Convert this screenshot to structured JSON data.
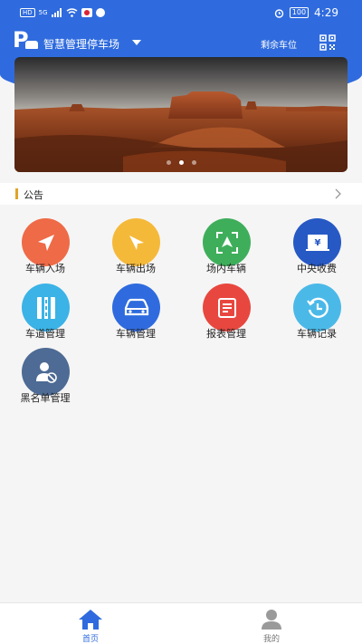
{
  "status_bar": {
    "left_badges": [
      "HD",
      "5G"
    ],
    "time": "4:29",
    "battery": "100"
  },
  "header": {
    "lot_name": "智慧管理停车场",
    "remaining_spots_label": "剩余车位",
    "brand_color": "#2f6bde"
  },
  "banner": {
    "slide_count": 3,
    "active_slide": 2
  },
  "notice": {
    "label": "公告",
    "accent_color": "#e0a42b"
  },
  "menu": {
    "items": [
      {
        "label": "车辆入场",
        "icon": "navigation-arrow-icon",
        "color": "#ef6a47"
      },
      {
        "label": "车辆出场",
        "icon": "exit-arrow-icon",
        "color": "#f5b93a"
      },
      {
        "label": "场内车辆",
        "icon": "parked-vehicle-icon",
        "color": "#3fae5b"
      },
      {
        "label": "中央收费",
        "icon": "payment-icon",
        "color": "#2659c4"
      },
      {
        "label": "车道管理",
        "icon": "lane-icon",
        "color": "#3bb3e6"
      },
      {
        "label": "车辆管理",
        "icon": "car-icon",
        "color": "#2f6bde"
      },
      {
        "label": "报表管理",
        "icon": "report-icon",
        "color": "#e8473f"
      },
      {
        "label": "车辆记录",
        "icon": "history-icon",
        "color": "#4bb9e8"
      },
      {
        "label": "黑名单管理",
        "icon": "blacklist-user-icon",
        "color": "#4d6b94"
      }
    ]
  },
  "bottom_nav": {
    "home_label": "首页",
    "mine_label": "我的",
    "active_color": "#2f6bde",
    "inactive_color": "#999999"
  }
}
